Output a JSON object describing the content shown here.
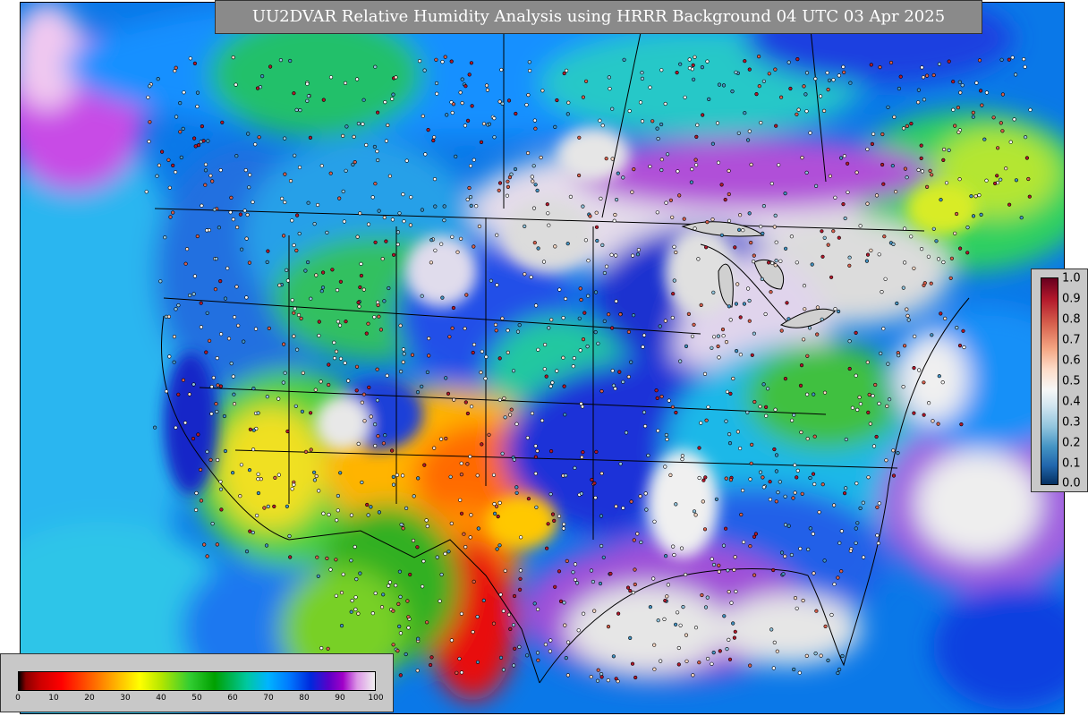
{
  "title": "UU2DVAR Relative Humidity Analysis using HRRR Background 04 UTC 03 Apr 2025",
  "rh_colorbar": {
    "ticks": [
      "0",
      "10",
      "20",
      "30",
      "40",
      "50",
      "60",
      "70",
      "80",
      "90",
      "100"
    ]
  },
  "obs_colorbar": {
    "ticks": [
      "1.0",
      "0.9",
      "0.8",
      "0.7",
      "0.6",
      "0.5",
      "0.4",
      "0.3",
      "0.2",
      "0.1",
      "0.0"
    ]
  },
  "colors": {
    "very_dry": "#cc0000",
    "dry": "#ff8c00",
    "moderate": "#32cd32",
    "moist": "#00b4ff",
    "humid": "#0028dc",
    "very_humid": "#a000c8",
    "saturated": "#e6e6e6",
    "title_background": "#8a8a8a",
    "legend_background": "#c8c8c8"
  }
}
